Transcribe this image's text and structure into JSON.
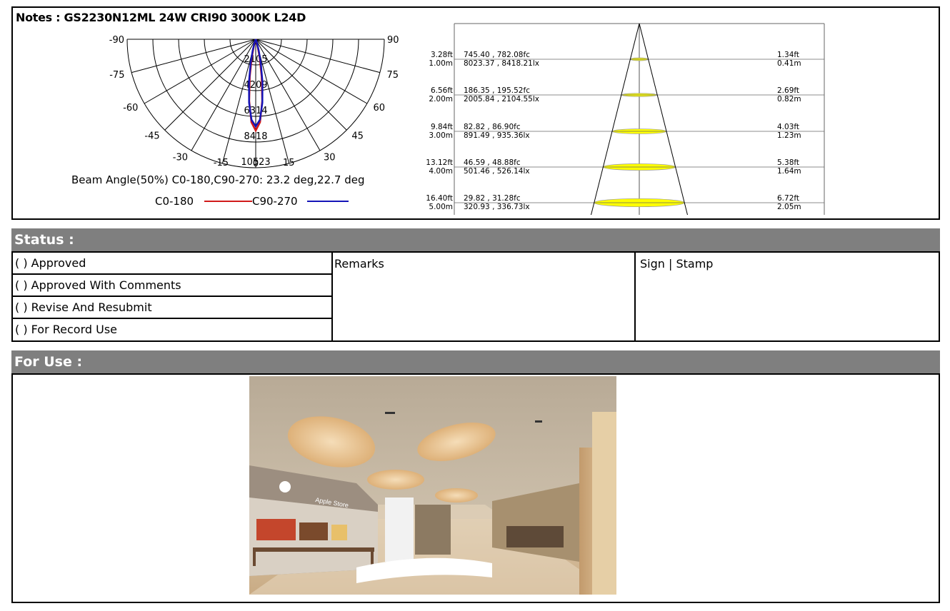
{
  "notes": {
    "title": "Notes : GS2230N12ML 24W CRI90 3000K L24D"
  },
  "polar": {
    "angle_labels": [
      "-90",
      "-75",
      "-60",
      "-45",
      "-30",
      "-15",
      "0",
      "15",
      "30",
      "45",
      "60",
      "75",
      "90"
    ],
    "intensity_labels": [
      "2105",
      "4209",
      "6314",
      "8418",
      "10523"
    ],
    "beam_text": "Beam Angle(50%) C0-180,C90-270: 23.2 deg,22.7 deg",
    "legend_c0": "C0-180",
    "legend_c90": "C90-270",
    "color_c0": "#d11a1a",
    "color_c90": "#1414b8"
  },
  "cone": {
    "rows": [
      {
        "ft": "3.28ft",
        "m": "1.00m",
        "fc": "745.40 , 782.08fc",
        "lx": "8023.37 , 8418.21lx",
        "dft": "1.34ft",
        "dm": "0.41m"
      },
      {
        "ft": "6.56ft",
        "m": "2.00m",
        "fc": "186.35 , 195.52fc",
        "lx": "2005.84 , 2104.55lx",
        "dft": "2.69ft",
        "dm": "0.82m"
      },
      {
        "ft": "9.84ft",
        "m": "3.00m",
        "fc": "82.82 , 86.90fc",
        "lx": "891.49 , 935.36lx",
        "dft": "4.03ft",
        "dm": "1.23m"
      },
      {
        "ft": "13.12ft",
        "m": "4.00m",
        "fc": "46.59 , 48.88fc",
        "lx": "501.46 , 526.14lx",
        "dft": "5.38ft",
        "dm": "1.64m"
      },
      {
        "ft": "16.40ft",
        "m": "5.00m",
        "fc": "29.82 , 31.28fc",
        "lx": "320.93 , 336.73lx",
        "dft": "6.72ft",
        "dm": "2.05m"
      }
    ],
    "ellipse_color": "#ffff00"
  },
  "status": {
    "title": "Status :",
    "options": [
      "(    ) Approved",
      "(    ) Approved With Comments",
      "(    ) Revise And Resubmit",
      "(    ) For Record Use"
    ],
    "remarks": "Remarks",
    "sign": "Sign | Stamp"
  },
  "use": {
    "title": "For  Use :",
    "store_sign": "Apple Store"
  }
}
